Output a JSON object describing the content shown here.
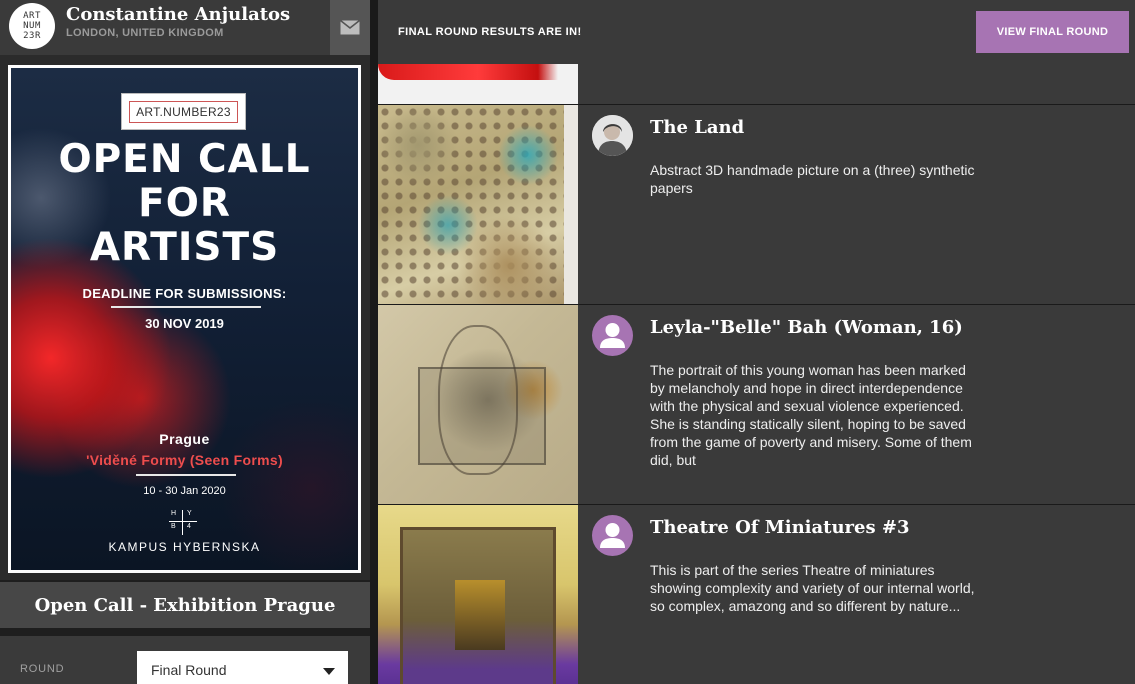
{
  "profile": {
    "logo_lines": [
      "ART",
      "NUM",
      "23R"
    ],
    "name": "Constantine Anjulatos",
    "location": "LONDON, UNITED KINGDOM"
  },
  "poster": {
    "badge": "ART.NUMBER23",
    "title_lines": [
      "OPEN CALL",
      "FOR",
      "ARTISTS"
    ],
    "deadline": "DEADLINE FOR SUBMISSIONS:",
    "deadline_date": "30 NOV 2019",
    "city": "Prague",
    "show": "'Viděné Formy (Seen Forms)",
    "dates": "10 - 30 Jan 2020",
    "venue_logo": [
      "H",
      "Y",
      "B",
      "4"
    ],
    "venue": "KAMPUS HYBERNSKA"
  },
  "exhibition": {
    "title": "Open Call - Exhibition Prague"
  },
  "round": {
    "label": "ROUND",
    "selected": "Final Round"
  },
  "banner": {
    "text": "FINAL ROUND RESULTS ARE IN!",
    "button": "VIEW FINAL ROUND"
  },
  "entries": [
    {
      "title": "The Land",
      "description": "Abstract 3D handmade picture on a (three) synthetic papers",
      "avatar": "photo"
    },
    {
      "title": "Leyla-\"Belle\" Bah (Woman, 16)",
      "description": "The portrait of this young woman has been marked by melancholy and hope in direct interdependence with the physical and sexual violence experienced. She is standing statically silent, hoping to be saved from the game of poverty and misery. Some of them did, but",
      "avatar": "default"
    },
    {
      "title": "Theatre Of Miniatures #3",
      "description": "This is part of the series Theatre of miniatures showing complexity and variety of our internal world, so complex, amazong and so different by nature...",
      "avatar": "default"
    }
  ],
  "colors": {
    "accent": "#a774b3",
    "panel": "#3a3a3a",
    "background": "#1a1a1a"
  }
}
